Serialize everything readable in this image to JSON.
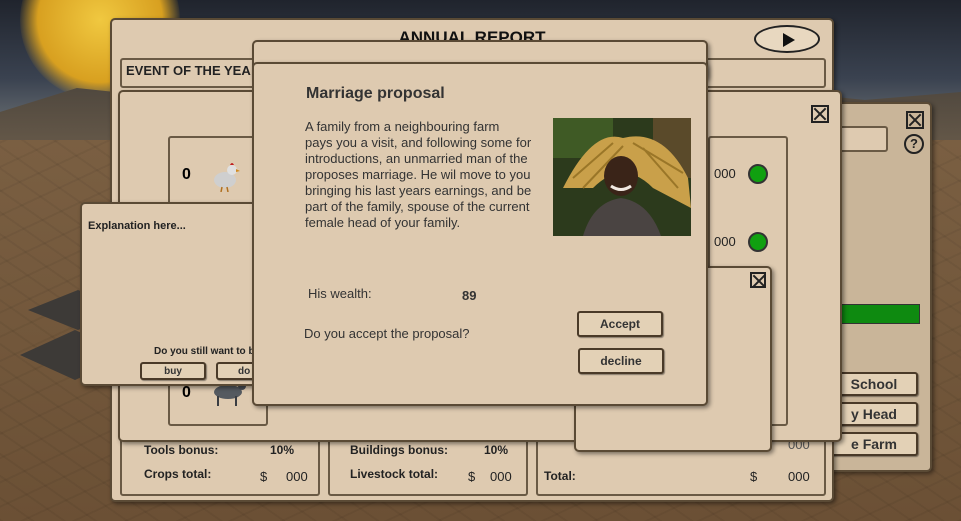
{
  "annual_report": {
    "title": "ANNUAL REPORT",
    "event_header": "EVENT OF THE YEA",
    "counts": {
      "chicken": "0",
      "goat": "0"
    },
    "right_values": {
      "row1": "000",
      "row2": "000"
    },
    "summary": {
      "tools_bonus_label": "Tools bonus:",
      "tools_bonus_value": "10%",
      "buildings_bonus_label": "Buildings bonus:",
      "buildings_bonus_value": "10%",
      "crops_total_label": "Crops total:",
      "crops_total_currency": "$",
      "crops_total_value": "000",
      "livestock_total_label": "Livestock total:",
      "livestock_total_currency": "$",
      "livestock_total_value": "000",
      "total_label": "Total:",
      "total_currency": "$",
      "total_value": "000",
      "partial_value": "000"
    }
  },
  "side_menu": {
    "school_label": "School",
    "head_label": "y Head",
    "farm_label": "e Farm",
    "help_symbol": "?"
  },
  "explanation_dialog": {
    "text": "Explanation here...",
    "question": "Do you still want to b",
    "buy_label": "buy",
    "other_label": "do"
  },
  "marriage_dialog": {
    "title": "Marriage proposal",
    "description_lines": [
      "A family from a neighbouring farm",
      "pays you a visit, and following some for",
      "introductions, an unmarried man of the",
      "proposes marriage. He wil move to you",
      "bringing his last years earnings, and be",
      "part of the family, spouse of the current",
      "female head of your family."
    ],
    "wealth_label": "His wealth:",
    "wealth_value": "89",
    "question": "Do you accept the proposal?",
    "accept_label": "Accept",
    "decline_label": "decline"
  },
  "icons": {
    "play": "play-icon",
    "close": "close-icon",
    "help": "help-icon"
  },
  "colors": {
    "panel_bg": "#decab0",
    "panel_border": "#5a4a35",
    "status_green": "#10a010",
    "progress_green": "#0e8a10"
  }
}
